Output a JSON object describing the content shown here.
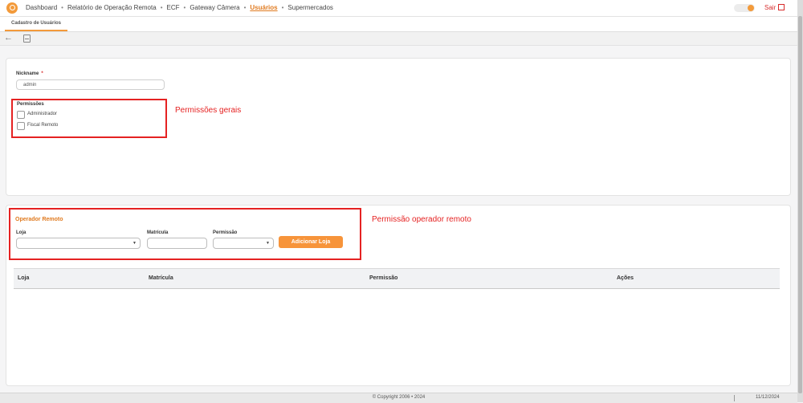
{
  "nav": {
    "items": [
      "Dashboard",
      "Relatório de Operação Remota",
      "ECF",
      "Gateway Câmera",
      "Usuários",
      "Supermercados"
    ],
    "separator": "•",
    "active_index": 4,
    "logout_label": "Sair"
  },
  "tab": {
    "label": "Cadastro de Usuários"
  },
  "toolbar": {
    "back_icon": "arrow-left-icon",
    "save_icon": "save-icon"
  },
  "user_form": {
    "nickname_label": "Nickname",
    "required_mark": "*",
    "nickname_value": "admin",
    "permissions_title": "Permissões",
    "permissions": [
      {
        "label": "Administrador",
        "checked": false
      },
      {
        "label": "Fiscal Remoto",
        "checked": false
      }
    ]
  },
  "annotations": {
    "general": "Permissões gerais",
    "remote": "Permissão operador remoto"
  },
  "remote_operator": {
    "title": "Operador Remoto",
    "store_label": "Loja",
    "store_value": "",
    "registration_label": "Matrícula",
    "registration_value": "",
    "permission_label": "Permissão",
    "permission_value": "",
    "add_button": "Adicionar Loja"
  },
  "table": {
    "columns": [
      "Loja",
      "Matrícula",
      "Permissão",
      "Ações"
    ],
    "rows": []
  },
  "footer": {
    "copyright": "© Copyright 2006 • 2024",
    "date": "11/12/2024"
  },
  "colors": {
    "accent": "#f7943a",
    "annotation": "#e52222",
    "logout": "#d72b2b"
  }
}
